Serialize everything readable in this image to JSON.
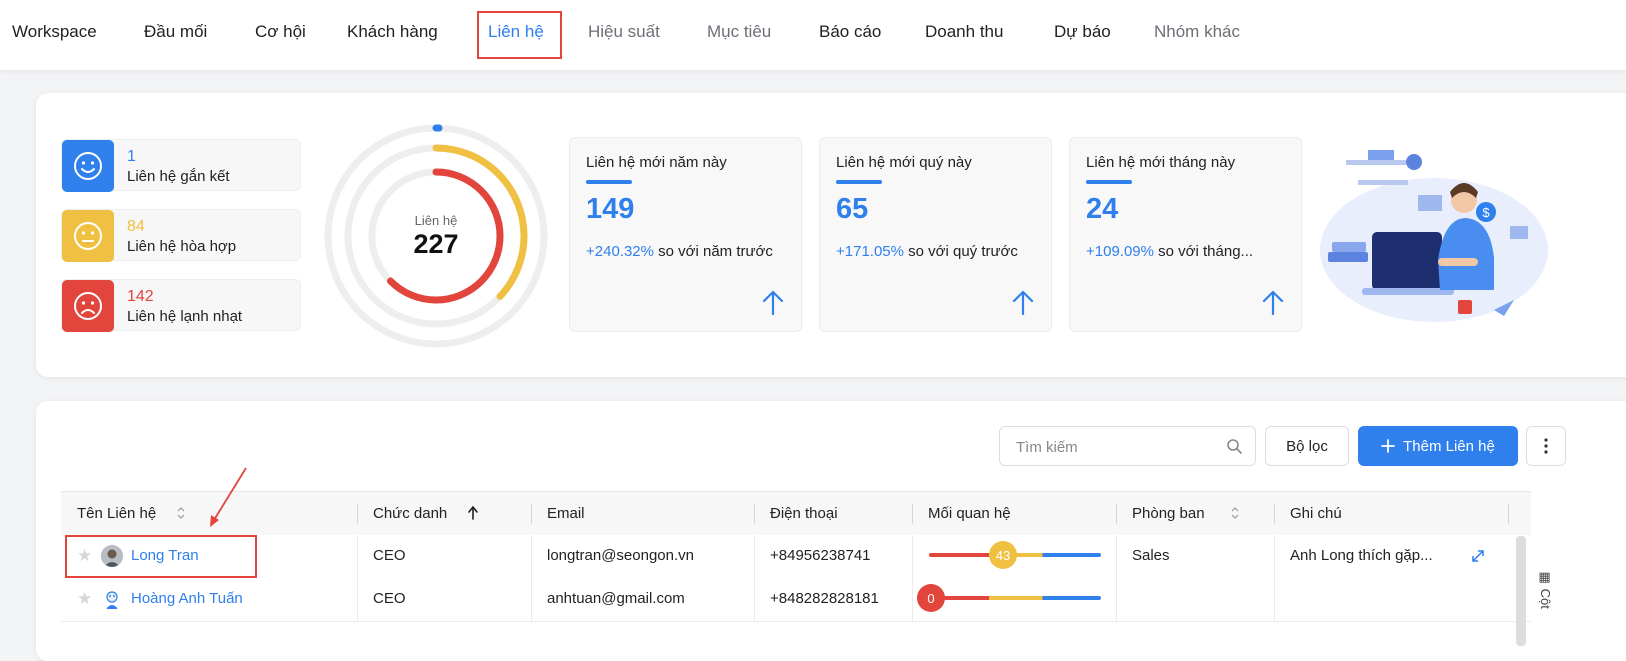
{
  "nav": {
    "tabs": [
      {
        "label": "Workspace"
      },
      {
        "label": "Đầu mối"
      },
      {
        "label": "Cơ hội"
      },
      {
        "label": "Khách hàng"
      },
      {
        "label": "Liên hệ"
      },
      {
        "label": "Hiệu suất"
      },
      {
        "label": "Mục tiêu"
      },
      {
        "label": "Báo cáo"
      },
      {
        "label": "Doanh thu"
      },
      {
        "label": "Dự báo"
      },
      {
        "label": "Nhóm khác"
      }
    ],
    "active": "Liên hệ"
  },
  "summary": {
    "moods": [
      {
        "count": "1",
        "label": "Liên hệ gắn kết",
        "color": "#2f80ed",
        "icon": "smile-icon"
      },
      {
        "count": "84",
        "label": "Liên hệ hòa hợp",
        "color": "#f0c043",
        "icon": "neutral-face-icon"
      },
      {
        "count": "142",
        "label": "Liên hệ lạnh nhạt",
        "color": "#e2453c",
        "icon": "sad-face-icon"
      }
    ],
    "donut": {
      "label": "Liên hệ",
      "total": "227",
      "segments": [
        {
          "value": 1,
          "color": "#2f80ed"
        },
        {
          "value": 84,
          "color": "#f0c043"
        },
        {
          "value": 142,
          "color": "#e2453c"
        }
      ]
    },
    "kpis": [
      {
        "title": "Liên hệ mới năm này",
        "value": "149",
        "change": "+240.32%",
        "compare": "so với năm trước"
      },
      {
        "title": "Liên hệ mới quý này",
        "value": "65",
        "change": "+171.05%",
        "compare": "so với quý trước"
      },
      {
        "title": "Liên hệ mới tháng này",
        "value": "24",
        "change": "+109.09%",
        "compare": "so với tháng..."
      }
    ]
  },
  "toolbar": {
    "search_placeholder": "Tìm kiếm",
    "filter_label": "Bộ lọc",
    "add_label": "Thêm Liên hệ"
  },
  "table": {
    "columns": [
      "Tên Liên hệ",
      "Chức danh",
      "Email",
      "Điện thoại",
      "Mối quan hệ",
      "Phòng ban",
      "Ghi chú"
    ],
    "rows": [
      {
        "name": "Long Tran",
        "title": "CEO",
        "email": "longtran@seongon.vn",
        "phone": "+84956238741",
        "relationship": 43,
        "department": "Sales",
        "note": "Anh Long thích gặp..."
      },
      {
        "name": "Hoàng Anh Tuấn",
        "title": "CEO",
        "email": "anhtuan@gmail.com",
        "phone": "+848282828181",
        "relationship": 0,
        "department": "",
        "note": ""
      }
    ]
  },
  "side_tab": "Cột",
  "colors": {
    "primary": "#2f80ed",
    "warn": "#f0c043",
    "danger": "#e2453c"
  }
}
